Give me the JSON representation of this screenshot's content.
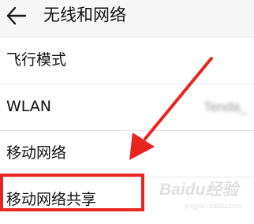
{
  "header": {
    "back_icon": "arrow-left-icon",
    "title": "无线和网络"
  },
  "rows": [
    {
      "label": "飞行模式",
      "value": ""
    },
    {
      "label": "WLAN",
      "value": "Tenda_"
    },
    {
      "label": "移动网络",
      "value": ""
    },
    {
      "label": "移动网络共享",
      "value": ""
    }
  ],
  "annotation": {
    "highlight_color": "#e8261f",
    "arrow_color": "#e8261f"
  },
  "watermark": {
    "text": "Baidu经验",
    "sub": "jingyan.baidu.com"
  }
}
